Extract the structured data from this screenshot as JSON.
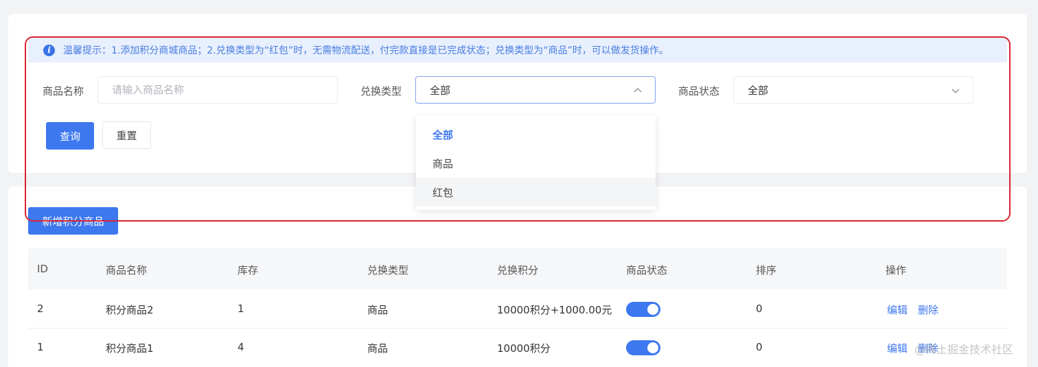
{
  "tip": {
    "text": "温馨提示：1.添加积分商城商品；2.兑换类型为“红包”时，无需物流配送，付完款直接是已完成状态；兑换类型为“商品”时，可以做发货操作。"
  },
  "filters": {
    "name_label": "商品名称",
    "name_placeholder": "请输入商品名称",
    "type_label": "兑换类型",
    "type_value": "全部",
    "status_label": "商品状态",
    "status_value": "全部"
  },
  "buttons": {
    "search": "查询",
    "reset": "重置",
    "add": "新增积分商品"
  },
  "dropdown": {
    "options": [
      "全部",
      "商品",
      "红包"
    ],
    "selected": "全部",
    "hovered": "红包"
  },
  "table": {
    "headers": [
      "ID",
      "商品名称",
      "库存",
      "兑换类型",
      "兑换积分",
      "商品状态",
      "排序",
      "操作"
    ],
    "rows": [
      {
        "id": "2",
        "name": "积分商品2",
        "stock": "1",
        "type": "商品",
        "points": "10000积分+1000.00元",
        "status_on": true,
        "sort": "0",
        "edit": "编辑",
        "delete": "删除"
      },
      {
        "id": "1",
        "name": "积分商品1",
        "stock": "4",
        "type": "商品",
        "points": "10000积分",
        "status_on": true,
        "sort": "0",
        "edit": "编辑",
        "delete": "删除"
      }
    ]
  },
  "watermark": "@稀土掘金技术社区",
  "colors": {
    "primary": "#3d78ef",
    "highlight_border": "#d9232e",
    "tip_bg": "#e8f0fe"
  }
}
